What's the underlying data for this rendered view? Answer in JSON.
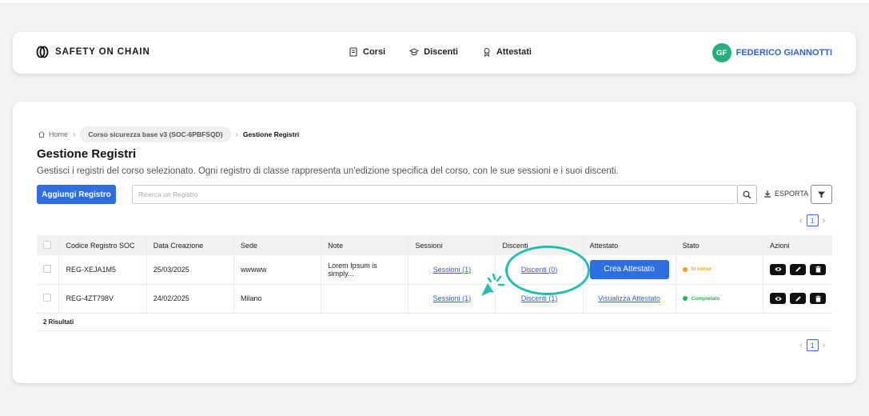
{
  "navbar": {
    "brand": "SAFETY ON CHAIN",
    "items": [
      {
        "label": "Corsi"
      },
      {
        "label": "Discenti"
      },
      {
        "label": "Attestati"
      }
    ],
    "user": {
      "initials": "GF",
      "name": "FEDERICO GIANNOTTI"
    }
  },
  "breadcrumb": {
    "home": "Home",
    "course": "Corso sicurezza base v3 (SOC-6PBFSQD)",
    "current": "Gestione Registri"
  },
  "page": {
    "title": "Gestione Registri",
    "subtitle": "Gestisci i registri del corso selezionato. Ogni registro di classe rappresenta un'edizione specifica del corso, con le sue sessioni e i suoi discenti."
  },
  "toolbar": {
    "add_label": "Aggiungi Registro",
    "search_placeholder": "Ricerca un Registro",
    "export_label": "ESPORTA"
  },
  "pagination": {
    "prev": "‹",
    "page": "1",
    "next": "›"
  },
  "table": {
    "headers": [
      "Codice Registro SOC",
      "Data Creazione",
      "Sede",
      "Note",
      "Sessioni",
      "Discenti",
      "Attestato",
      "Stato",
      "Azioni"
    ],
    "rows": [
      {
        "codice": "REG-XEJA1M5",
        "data": "25/03/2025",
        "sede": "wwwww",
        "note": "Lorem Ipsum is simply...",
        "sessioni": "Sessioni (1)",
        "discenti": "Discenti (0)",
        "attestato": "Crea Attestato",
        "stato": "In corso"
      },
      {
        "codice": "REG-4ZT798V",
        "data": "24/02/2025",
        "sede": "Milano",
        "note": "",
        "sessioni": "Sessioni (1)",
        "discenti": "Discenti (1)",
        "attestato": "Visualizza Attestato",
        "stato": "Completato"
      }
    ],
    "results": "2 Risultati"
  },
  "colors": {
    "primary": "#2d6ee0",
    "avatar": "#22b07d",
    "status_in_corso": "#f0a500",
    "status_completato": "#1db954",
    "highlight": "#20bfb0"
  },
  "icons": [
    "brand-logo-icon",
    "book-icon",
    "graduation-cap-icon",
    "certificate-icon",
    "home-icon",
    "search-icon",
    "download-icon",
    "filter-icon",
    "eye-icon",
    "pencil-icon",
    "trash-icon",
    "click-cursor-icon"
  ]
}
